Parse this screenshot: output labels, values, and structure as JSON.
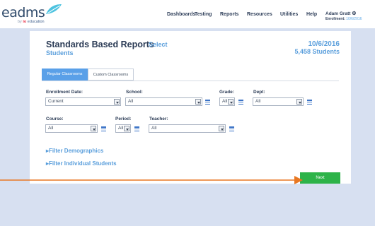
{
  "brand": {
    "logo_text": "eadms",
    "logo_sub_prefix": "by",
    "logo_sub": "education"
  },
  "nav": {
    "items": [
      "Dashboards",
      "Testing",
      "Reports",
      "Resources",
      "Utilities",
      "Help"
    ]
  },
  "user": {
    "name": "Adam Gratt",
    "enrollment_label": "Enrollment:",
    "enrollment_date": "10/6/2016"
  },
  "page": {
    "title": "Standards Based Reports",
    "breadcrumb_select": "Select",
    "breadcrumb_students": "Students",
    "date": "10/6/2016",
    "student_count": "5,458 Students"
  },
  "tabs": [
    {
      "label": "Regular Classrooms",
      "active": true
    },
    {
      "label": "Custom Classrooms",
      "active": false
    }
  ],
  "filters": {
    "enrollment_date": {
      "label": "Enrollment Date:",
      "value": "Current"
    },
    "school": {
      "label": "School:",
      "value": "All"
    },
    "grade": {
      "label": "Grade:",
      "value": "All"
    },
    "dept": {
      "label": "Dept:",
      "value": "All"
    },
    "course": {
      "label": "Course:",
      "value": "All"
    },
    "period": {
      "label": "Period:",
      "value": "All"
    },
    "teacher": {
      "label": "Teacher:",
      "value": "All"
    }
  },
  "links": {
    "demographics": "Filter Demographics",
    "individual_students": "Filter Individual Students"
  },
  "actions": {
    "next": "Next"
  },
  "colors": {
    "accent": "#5b9fdc",
    "next_button": "#2db349",
    "annotation_arrow": "#e87722",
    "background": "#d7e0f1"
  }
}
